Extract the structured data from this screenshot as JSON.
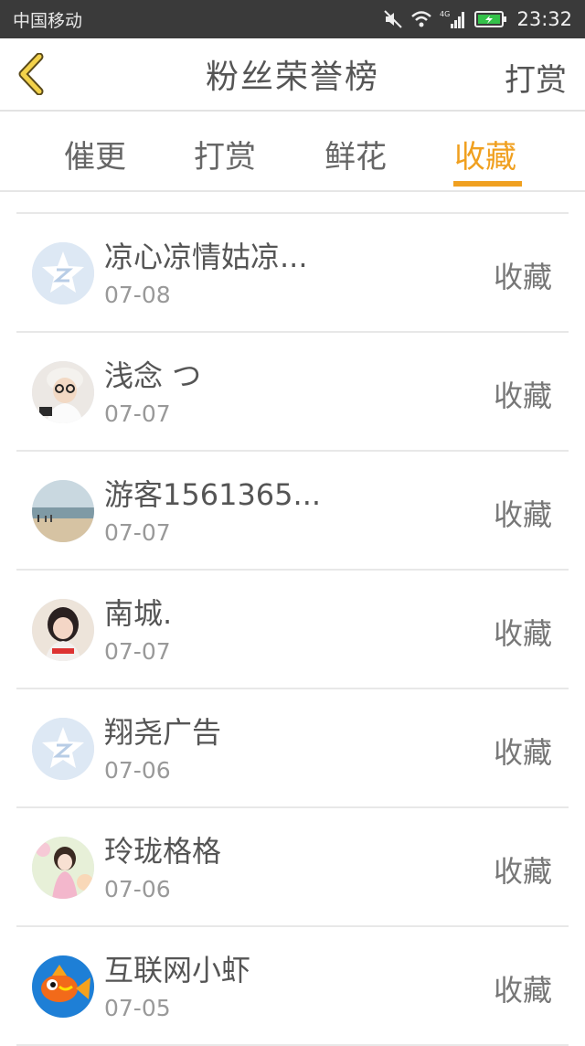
{
  "status_bar": {
    "carrier": "中国移动",
    "network": "4G",
    "time": "23:32"
  },
  "header": {
    "back_icon": "chevron-left-icon",
    "title": "粉丝荣誉榜",
    "action_label": "打赏"
  },
  "tabs": [
    {
      "label": "催更"
    },
    {
      "label": "打赏"
    },
    {
      "label": "鲜花"
    },
    {
      "label": "收藏"
    }
  ],
  "active_tab": "收藏",
  "accent_color": "#f0a020",
  "list": [
    {
      "name": "凉心凉情姑凉...",
      "date": "07-08",
      "action": "收藏",
      "avatar": "qq-default-icon"
    },
    {
      "name": "浅念 つ",
      "date": "07-07",
      "action": "收藏",
      "avatar": "user-photo"
    },
    {
      "name": "游客1561365...",
      "date": "07-07",
      "action": "收藏",
      "avatar": "beach-photo"
    },
    {
      "name": "南城.",
      "date": "07-07",
      "action": "收藏",
      "avatar": "girl-photo"
    },
    {
      "name": "翔尧广告",
      "date": "07-06",
      "action": "收藏",
      "avatar": "qq-default-icon"
    },
    {
      "name": "玲珑格格",
      "date": "07-06",
      "action": "收藏",
      "avatar": "illustration-photo"
    },
    {
      "name": "互联网小虾",
      "date": "07-05",
      "action": "收藏",
      "avatar": "fish-icon"
    }
  ]
}
